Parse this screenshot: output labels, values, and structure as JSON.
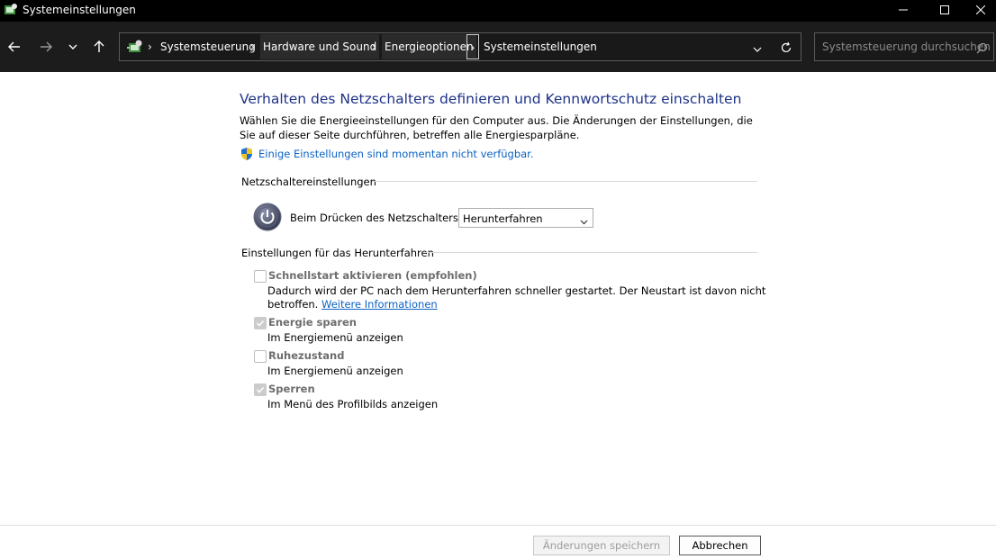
{
  "window": {
    "title": "Systemeinstellungen"
  },
  "breadcrumb": {
    "items": [
      {
        "label": "Systemsteuerung"
      },
      {
        "label": "Hardware und Sound"
      },
      {
        "label": "Energieoptionen"
      },
      {
        "label": "Systemeinstellungen"
      }
    ]
  },
  "search": {
    "placeholder": "Systemsteuerung durchsuchen"
  },
  "main": {
    "heading": "Verhalten des Netzschalters definieren und Kennwortschutz einschalten",
    "intro": "Wählen Sie die Energieeinstellungen für den Computer aus. Die Änderungen der Einstellungen, die Sie auf dieser Seite durchführen, betreffen alle Energiesparpläne.",
    "unavailable_link": "Einige Einstellungen sind momentan nicht verfügbar.",
    "power_section": {
      "title": "Netzschaltereinstellungen",
      "label": "Beim Drücken des Netzschalters:",
      "value": "Herunterfahren"
    },
    "shutdown_section": {
      "title": "Einstellungen für das Herunterfahren",
      "options": [
        {
          "label": "Schnellstart aktivieren (empfohlen)",
          "desc": "Dadurch wird der PC nach dem Herunterfahren schneller gestartet. Der Neustart ist davon nicht",
          "desc2": "betroffen.",
          "link": "Weitere Informationen",
          "checked": false
        },
        {
          "label": "Energie sparen",
          "desc": "Im Energiemenü anzeigen",
          "checked": true
        },
        {
          "label": "Ruhezustand",
          "desc": "Im Energiemenü anzeigen",
          "checked": false
        },
        {
          "label": "Sperren",
          "desc": "Im Menü des Profilbilds anzeigen",
          "checked": true
        }
      ]
    }
  },
  "footer": {
    "save_label": "Änderungen speichern",
    "cancel_label": "Abbrechen"
  },
  "colors": {
    "heading": "#1e3287",
    "link": "#0b61c4",
    "navbar": "#1c1c1c"
  }
}
